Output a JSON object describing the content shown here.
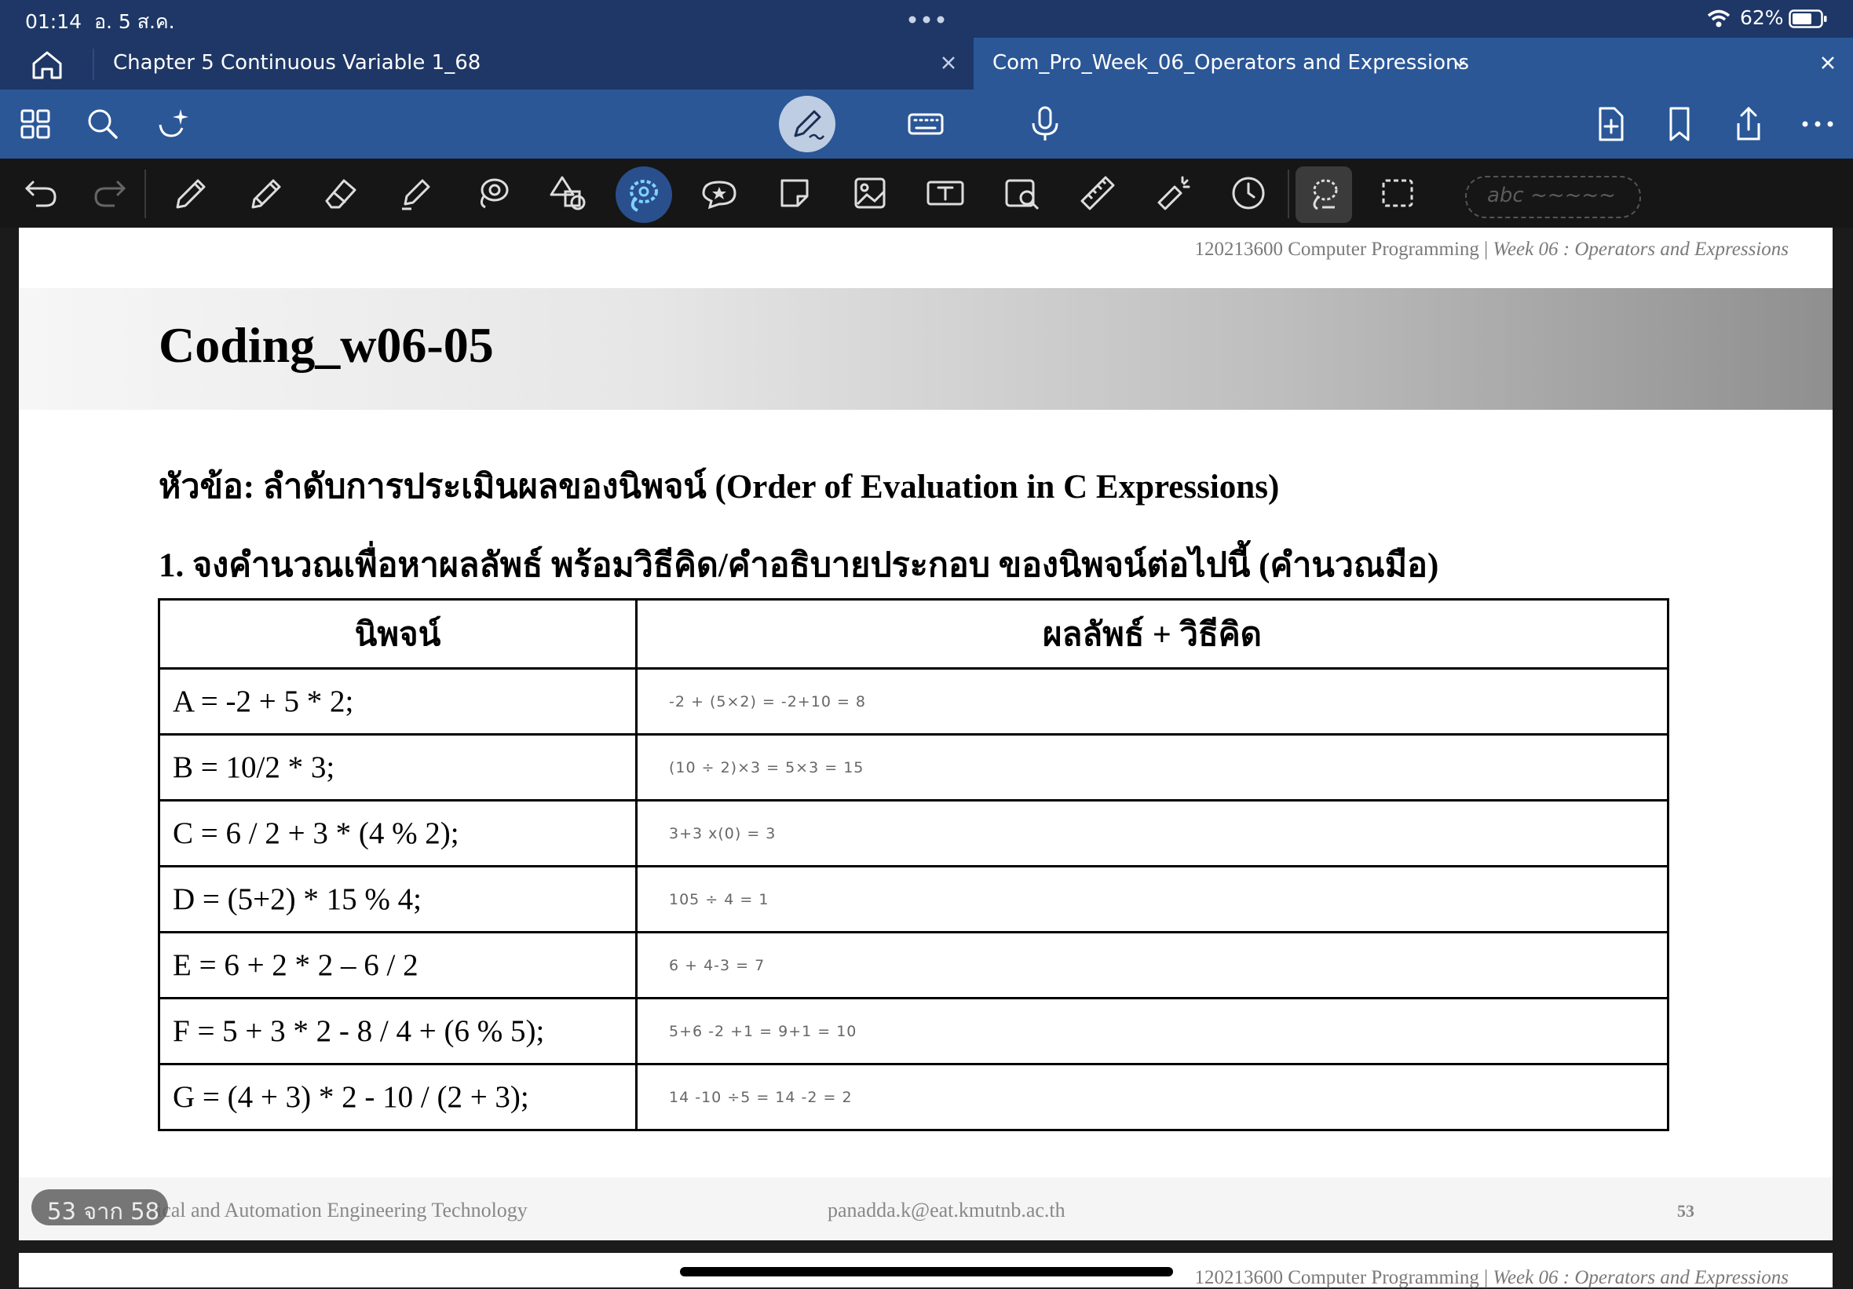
{
  "status_bar": {
    "time": "01:14",
    "date": "อ. 5 ส.ค.",
    "battery": "62%"
  },
  "tabs": [
    {
      "label": "Chapter 5 Continuous Variable 1_68",
      "active": false
    },
    {
      "label": "Com_Pro_Week_06_Operators and Expressions",
      "active": true
    }
  ],
  "toolbar": {
    "left_icons": [
      "grid-icon",
      "search-icon",
      "ai-sparkle-icon"
    ],
    "center_icons": [
      "pen-mode-icon",
      "keyboard-icon",
      "microphone-icon"
    ],
    "right_icons": [
      "add-page-icon",
      "bookmark-icon",
      "share-icon",
      "more-icon"
    ]
  },
  "tools": {
    "icons": [
      "undo-icon",
      "redo-icon",
      "pen-icon",
      "pencil-icon",
      "eraser-icon",
      "highlighter-icon",
      "lasso-fill-icon",
      "shapes-icon",
      "highlighter-active-icon",
      "sticker-icon",
      "sticky-note-icon",
      "image-icon",
      "text-box-icon",
      "camera-icon",
      "ruler-icon",
      "laser-pointer-icon",
      "timer-icon",
      "lasso-icon",
      "selection-icon"
    ],
    "handwriting_pill": "abc ~~~~~"
  },
  "slide": {
    "course": "120213600 Computer Programming | ",
    "course_week": "Week 06 : Operators and Expressions",
    "title": "Coding_w06-05",
    "topic": "หัวข้อ: ลำดับการประเมินผลของนิพจน์ (Order of Evaluation in C Expressions)",
    "question": "1. จงคำนวณเพื่อหาผลลัพธ์ พร้อมวิธีคิด/คำอธิบายประกอบ ของนิพจน์ต่อไปนี้ (คำนวณมือ)",
    "table": {
      "headers": [
        "นิพจน์",
        "ผลลัพธ์ + วิธีคิด"
      ],
      "rows": [
        {
          "expression": "A = -2 + 5 * 2;",
          "answer": "-2 + (5×2) = -2+10 = 8"
        },
        {
          "expression": "B = 10/2 * 3;",
          "answer": "(10 ÷ 2)×3 = 5×3 = 15"
        },
        {
          "expression": "C = 6 / 2 + 3 * (4 % 2);",
          "answer": "3+3 x(0) = 3"
        },
        {
          "expression": "D = (5+2) * 15 % 4;",
          "answer": "105 ÷ 4  = 1"
        },
        {
          "expression": "E = 6 + 2 * 2 – 6 / 2",
          "answer": "6 + 4-3 = 7"
        },
        {
          "expression": "F = 5 + 3 * 2 - 8 / 4 + (6 % 5);",
          "answer": "5+6 -2 +1  = 9+1 = 10"
        },
        {
          "expression": "G = (4 + 3) * 2 - 10 / (2 + 3);",
          "answer": "14 -10 ÷5  = 14 -2  = 2"
        }
      ]
    },
    "footer": {
      "institution": "ical and Automation Engineering Technology",
      "email": "panadda.k@eat.kmutnb.ac.th",
      "page_number": "53"
    }
  },
  "page_indicator": "53 จาก 58"
}
